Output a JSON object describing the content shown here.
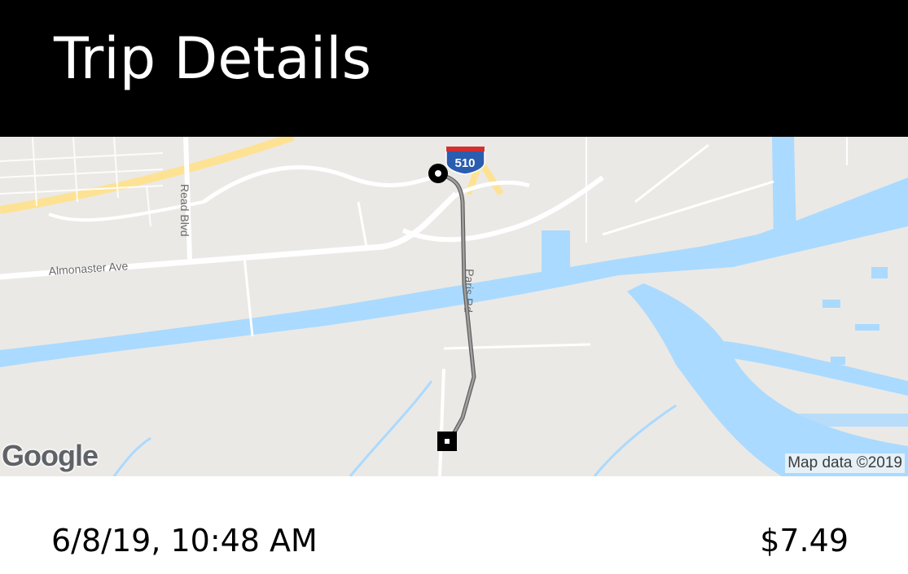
{
  "header": {
    "title": "Trip Details"
  },
  "map": {
    "streets": {
      "almonaster": "Almonaster Ave",
      "read_blvd": "Read Blvd",
      "paris_rd": "Paris Rd"
    },
    "interstate_shield": "510",
    "attribution": "Map data ©2019",
    "logo": "Google",
    "colors": {
      "land": "#ebe9e5",
      "water": "#aadaff",
      "highway": "#fde293",
      "route": "#808080",
      "roads": "#ffffff"
    },
    "icons": {
      "origin": "circle-pin-icon",
      "destination": "square-pin-icon"
    }
  },
  "trip": {
    "datetime": "6/8/19, 10:48 AM",
    "fare": "$7.49"
  }
}
